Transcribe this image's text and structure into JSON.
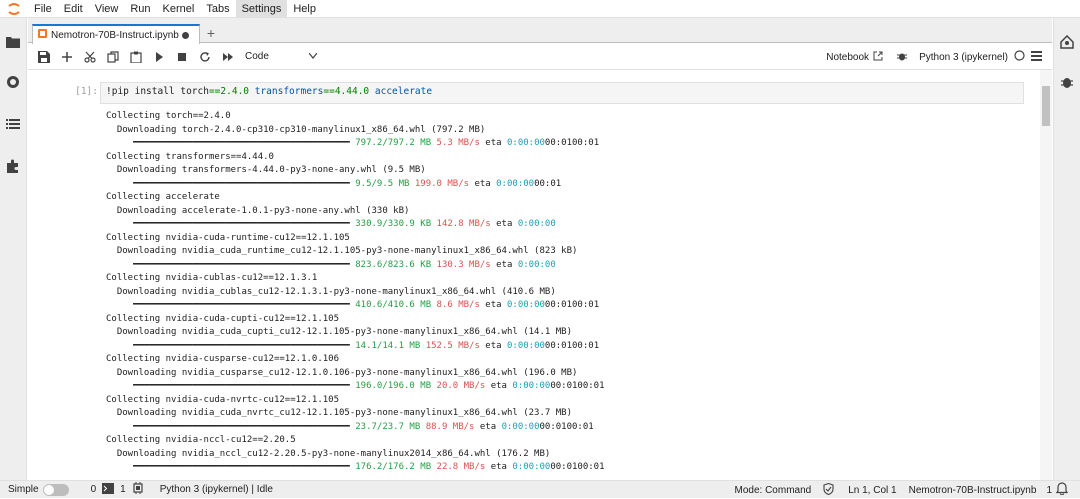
{
  "menubar": {
    "items": [
      "File",
      "Edit",
      "View",
      "Run",
      "Kernel",
      "Tabs",
      "Settings",
      "Help"
    ],
    "active": "Settings"
  },
  "tab": {
    "title": "Nemotron-70B-Instruct.ipynb",
    "add_label": "+"
  },
  "toolbar": {
    "cell_type": "Code",
    "notebook_label": "Notebook",
    "kernel_name": "Python 3 (ipykernel)"
  },
  "cell": {
    "prompt": "[1]:",
    "code_parts": [
      "!pip install torch",
      "==",
      "2.4.0",
      " transformers",
      "==",
      "4.44.0",
      " accelerate"
    ],
    "output_lines": [
      [
        {
          "t": "Collecting torch==2.4.0",
          "c": ""
        }
      ],
      [
        {
          "t": "  Downloading torch-2.4.0-cp310-cp310-manylinux1_x86_64.whl (797.2 MB)",
          "c": ""
        }
      ],
      [
        {
          "t": "     ━━━━━━━━━━━━━━━━━━━━━━━━━━━━━━━━━━━━━━━━ ",
          "c": ""
        },
        {
          "t": "797.2/797.2 MB",
          "c": "g"
        },
        {
          "t": " 5.3 MB/s",
          "c": "r"
        },
        {
          "t": " eta ",
          "c": ""
        },
        {
          "t": "0:00:00",
          "c": "c"
        },
        {
          "t": "00:0100:01",
          "c": ""
        }
      ],
      [
        {
          "t": "Collecting transformers==4.44.0",
          "c": ""
        }
      ],
      [
        {
          "t": "  Downloading transformers-4.44.0-py3-none-any.whl (9.5 MB)",
          "c": ""
        }
      ],
      [
        {
          "t": "     ━━━━━━━━━━━━━━━━━━━━━━━━━━━━━━━━━━━━━━━━ ",
          "c": ""
        },
        {
          "t": "9.5/9.5 MB",
          "c": "g"
        },
        {
          "t": " 199.0 MB/s",
          "c": "r"
        },
        {
          "t": " eta ",
          "c": ""
        },
        {
          "t": "0:00:00",
          "c": "c"
        },
        {
          "t": "00:01",
          "c": ""
        }
      ],
      [
        {
          "t": "Collecting accelerate",
          "c": ""
        }
      ],
      [
        {
          "t": "  Downloading accelerate-1.0.1-py3-none-any.whl (330 kB)",
          "c": ""
        }
      ],
      [
        {
          "t": "     ━━━━━━━━━━━━━━━━━━━━━━━━━━━━━━━━━━━━━━━━ ",
          "c": ""
        },
        {
          "t": "330.9/330.9 KB",
          "c": "g"
        },
        {
          "t": " 142.8 MB/s",
          "c": "r"
        },
        {
          "t": " eta ",
          "c": ""
        },
        {
          "t": "0:00:00",
          "c": "c"
        }
      ],
      [
        {
          "t": "Collecting nvidia-cuda-runtime-cu12==12.1.105",
          "c": ""
        }
      ],
      [
        {
          "t": "  Downloading nvidia_cuda_runtime_cu12-12.1.105-py3-none-manylinux1_x86_64.whl (823 kB)",
          "c": ""
        }
      ],
      [
        {
          "t": "     ━━━━━━━━━━━━━━━━━━━━━━━━━━━━━━━━━━━━━━━━ ",
          "c": ""
        },
        {
          "t": "823.6/823.6 KB",
          "c": "g"
        },
        {
          "t": " 130.3 MB/s",
          "c": "r"
        },
        {
          "t": " eta ",
          "c": ""
        },
        {
          "t": "0:00:00",
          "c": "c"
        }
      ],
      [
        {
          "t": "Collecting nvidia-cublas-cu12==12.1.3.1",
          "c": ""
        }
      ],
      [
        {
          "t": "  Downloading nvidia_cublas_cu12-12.1.3.1-py3-none-manylinux1_x86_64.whl (410.6 MB)",
          "c": ""
        }
      ],
      [
        {
          "t": "     ━━━━━━━━━━━━━━━━━━━━━━━━━━━━━━━━━━━━━━━━ ",
          "c": ""
        },
        {
          "t": "410.6/410.6 MB",
          "c": "g"
        },
        {
          "t": " 8.6 MB/s",
          "c": "r"
        },
        {
          "t": " eta ",
          "c": ""
        },
        {
          "t": "0:00:00",
          "c": "c"
        },
        {
          "t": "00:0100:01",
          "c": ""
        }
      ],
      [
        {
          "t": "Collecting nvidia-cuda-cupti-cu12==12.1.105",
          "c": ""
        }
      ],
      [
        {
          "t": "  Downloading nvidia_cuda_cupti_cu12-12.1.105-py3-none-manylinux1_x86_64.whl (14.1 MB)",
          "c": ""
        }
      ],
      [
        {
          "t": "     ━━━━━━━━━━━━━━━━━━━━━━━━━━━━━━━━━━━━━━━━ ",
          "c": ""
        },
        {
          "t": "14.1/14.1 MB",
          "c": "g"
        },
        {
          "t": " 152.5 MB/s",
          "c": "r"
        },
        {
          "t": " eta ",
          "c": ""
        },
        {
          "t": "0:00:00",
          "c": "c"
        },
        {
          "t": "00:0100:01",
          "c": ""
        }
      ],
      [
        {
          "t": "Collecting nvidia-cusparse-cu12==12.1.0.106",
          "c": ""
        }
      ],
      [
        {
          "t": "  Downloading nvidia_cusparse_cu12-12.1.0.106-py3-none-manylinux1_x86_64.whl (196.0 MB)",
          "c": ""
        }
      ],
      [
        {
          "t": "     ━━━━━━━━━━━━━━━━━━━━━━━━━━━━━━━━━━━━━━━━ ",
          "c": ""
        },
        {
          "t": "196.0/196.0 MB",
          "c": "g"
        },
        {
          "t": " 20.0 MB/s",
          "c": "r"
        },
        {
          "t": " eta ",
          "c": ""
        },
        {
          "t": "0:00:00",
          "c": "c"
        },
        {
          "t": "00:0100:01",
          "c": ""
        }
      ],
      [
        {
          "t": "Collecting nvidia-cuda-nvrtc-cu12==12.1.105",
          "c": ""
        }
      ],
      [
        {
          "t": "  Downloading nvidia_cuda_nvrtc_cu12-12.1.105-py3-none-manylinux1_x86_64.whl (23.7 MB)",
          "c": ""
        }
      ],
      [
        {
          "t": "     ━━━━━━━━━━━━━━━━━━━━━━━━━━━━━━━━━━━━━━━━ ",
          "c": ""
        },
        {
          "t": "23.7/23.7 MB",
          "c": "g"
        },
        {
          "t": " 88.9 MB/s",
          "c": "r"
        },
        {
          "t": " eta ",
          "c": ""
        },
        {
          "t": "0:00:00",
          "c": "c"
        },
        {
          "t": "00:0100:01",
          "c": ""
        }
      ],
      [
        {
          "t": "Collecting nvidia-nccl-cu12==2.20.5",
          "c": ""
        }
      ],
      [
        {
          "t": "  Downloading nvidia_nccl_cu12-2.20.5-py3-none-manylinux2014_x86_64.whl (176.2 MB)",
          "c": ""
        }
      ],
      [
        {
          "t": "     ━━━━━━━━━━━━━━━━━━━━━━━━━━━━━━━━━━━━━━━━ ",
          "c": ""
        },
        {
          "t": "176.2/176.2 MB",
          "c": "g"
        },
        {
          "t": " 22.8 MB/s",
          "c": "r"
        },
        {
          "t": " eta ",
          "c": ""
        },
        {
          "t": "0:00:00",
          "c": "c"
        },
        {
          "t": "00:0100:01",
          "c": ""
        }
      ]
    ]
  },
  "statusbar": {
    "simple_label": "Simple",
    "terminals_count": "0",
    "kernels_count": "1",
    "kernel_status": "Python 3 (ipykernel) | Idle",
    "mode": "Mode: Command",
    "position": "Ln 1, Col 1",
    "filename": "Nemotron-70B-Instruct.ipynb",
    "notifications": "1"
  },
  "colors": {
    "accent": "#1976d2",
    "progress_done": "#22a043",
    "speed": "#d9534f",
    "eta": "#17a2b8"
  },
  "icons": [
    "jupyter-logo-icon",
    "folder-icon",
    "running-icon",
    "toc-icon",
    "extension-icon",
    "notebook-icon",
    "save-icon",
    "add-cell-icon",
    "cut-icon",
    "copy-icon",
    "paste-icon",
    "run-icon",
    "stop-icon",
    "restart-icon",
    "fast-forward-icon",
    "chevron-down-icon",
    "external-link-icon",
    "debugger-icon",
    "kernel-idle-icon",
    "menu-icon",
    "property-inspector-icon",
    "bug-icon",
    "terminal-icon",
    "kernel-icon",
    "shield-check-icon",
    "bell-icon"
  ]
}
